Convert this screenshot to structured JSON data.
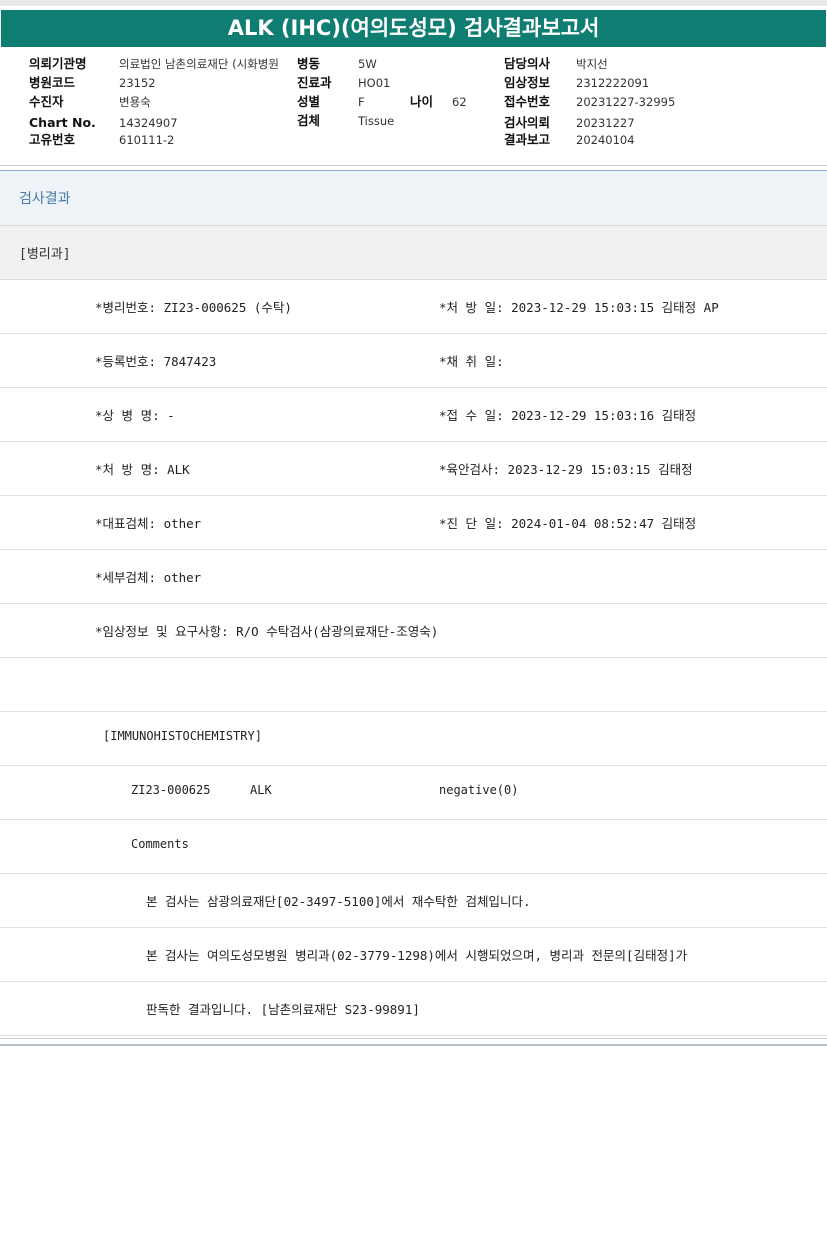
{
  "title": "ALK (IHC)(여의도성모) 검사결과보고서",
  "header": {
    "institution_label": "의뢰기관명",
    "institution_value": "의료법인 남촌의료재단 (시화병원",
    "ward_label": "병동",
    "ward_value": "5W",
    "doctor_label": "담당의사",
    "doctor_value": "박지선",
    "hospital_code_label": "병원코드",
    "hospital_code_value": "23152",
    "dept_label": "진료과",
    "dept_value": "HO01",
    "clinical_label": "임상정보",
    "clinical_value": "2312222091",
    "patient_label": "수진자",
    "patient_value": "변용숙",
    "sex_label": "성별",
    "sex_value": "F",
    "age_label": "나이",
    "age_value": "62",
    "receipt_label": "접수번호",
    "receipt_value": "20231227-32995",
    "chart_label": "Chart No.",
    "chart_value": "14324907",
    "specimen_label": "검체",
    "specimen_value": "Tissue",
    "request_label": "검사의뢰",
    "request_value": "20231227",
    "unique_label": "고유번호",
    "unique_value": "610111-2",
    "report_label": "결과보고",
    "report_value": "20240104"
  },
  "section_title": "검사결과",
  "dept_tag": "[병리과]",
  "details": {
    "path_no": "*병리번호: ZI23-000625 (수탁)",
    "order_date": "*처 방 일: 2023-12-29 15:03:15  김태정 AP",
    "reg_no": "*등록번호: 7847423",
    "collect_date": "*채 취 일:",
    "disease": "*상 병 명: -",
    "receive_date": "*접 수 일: 2023-12-29 15:03:16  김태정",
    "order_name": "*처 방 명: ALK",
    "gross_exam": "*육안검사: 2023-12-29 15:03:15  김태정",
    "rep_specimen": "*대표검체: other",
    "diag_date": "*진 단 일: 2024-01-04 08:52:47  김태정",
    "detail_specimen": "*세부검체: other",
    "clinical_req": "*임상정보 및 요구사항: R/O 수탁검사(삼광의료재단-조영숙)"
  },
  "ihc": {
    "heading": "[IMMUNOHISTOCHEMISTRY]",
    "case_no": "ZI23-000625",
    "marker": "ALK",
    "result": "negative(0)",
    "comments_label": "Comments",
    "comment1": "본 검사는 삼광의료재단[02-3497-5100]에서 재수탁한 검체입니다.",
    "comment2": "본 검사는 여의도성모병원 병리과(02-3779-1298)에서 시행되었으며, 병리과 전문의[김태정]가",
    "comment3": "판독한 결과입니다. [남촌의료재단 S23-99891]"
  }
}
